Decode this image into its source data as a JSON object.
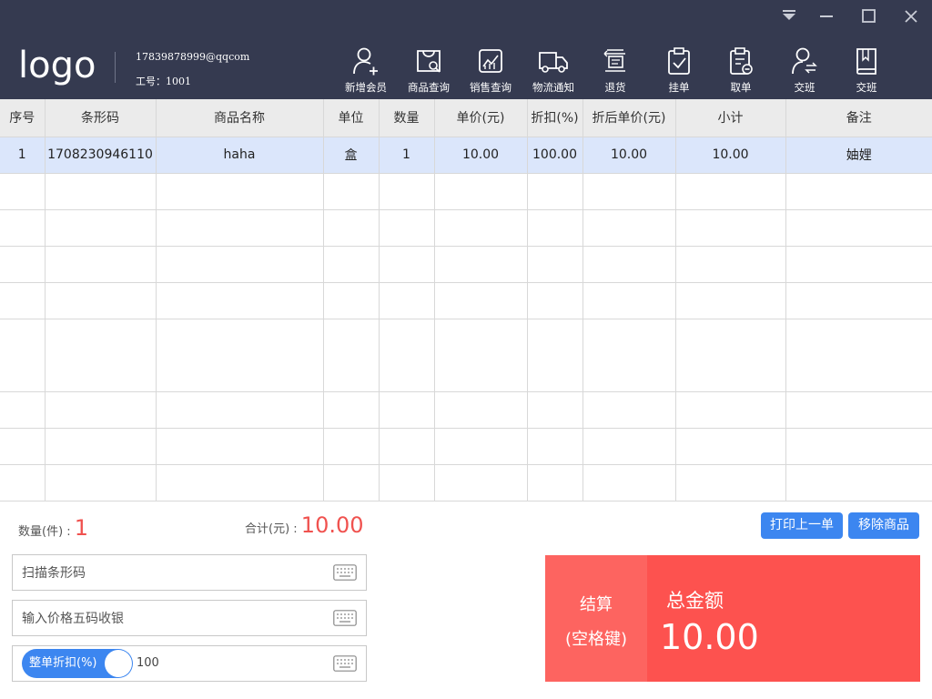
{
  "window": {
    "controls": [
      "dropdown-icon",
      "minimize-icon",
      "maximize-icon",
      "close-icon"
    ]
  },
  "header": {
    "logo": "logo",
    "email": "17839878999@qqcom",
    "employee": "工号：1001"
  },
  "toolbar": [
    {
      "label": "新增会员",
      "icon": "add-member-icon"
    },
    {
      "label": "商品查询",
      "icon": "product-search-icon"
    },
    {
      "label": "销售查询",
      "icon": "sales-query-icon"
    },
    {
      "label": "物流通知",
      "icon": "truck-icon"
    },
    {
      "label": "退货",
      "icon": "return-icon"
    },
    {
      "label": "挂单",
      "icon": "hold-order-icon"
    },
    {
      "label": "取单",
      "icon": "retrieve-order-icon"
    },
    {
      "label": "交班",
      "icon": "handover-icon"
    },
    {
      "label": "交班",
      "icon": "book-icon"
    }
  ],
  "table": {
    "headers": [
      "序号",
      "条形码",
      "商品名称",
      "单位",
      "数量",
      "单价(元)",
      "折扣(%)",
      "折后单价(元)",
      "小计",
      "备注"
    ],
    "rows": [
      [
        "1",
        "1708230946110",
        "haha",
        "盒",
        "1",
        "10.00",
        "100.00",
        "10.00",
        "10.00",
        "妯娌"
      ]
    ]
  },
  "summary": {
    "qty_label": "数量(件) :",
    "qty_value": "1",
    "sum_label": "合计(元) :",
    "sum_value": "10.00"
  },
  "actions": {
    "print_last": "打印上一单",
    "remove_item": "移除商品"
  },
  "inputs": {
    "barcode_placeholder": "扫描条形码",
    "price_placeholder": "输入价格五码收银",
    "discount_label": "整单折扣(%)",
    "discount_value": "100"
  },
  "checkout": {
    "label": "结算",
    "hint": "(空格键)",
    "total_label": "总金额",
    "total_value": "10.00"
  },
  "colors": {
    "header_bg": "#353a50",
    "accent": "#3c86f0",
    "danger": "#fd524f"
  }
}
